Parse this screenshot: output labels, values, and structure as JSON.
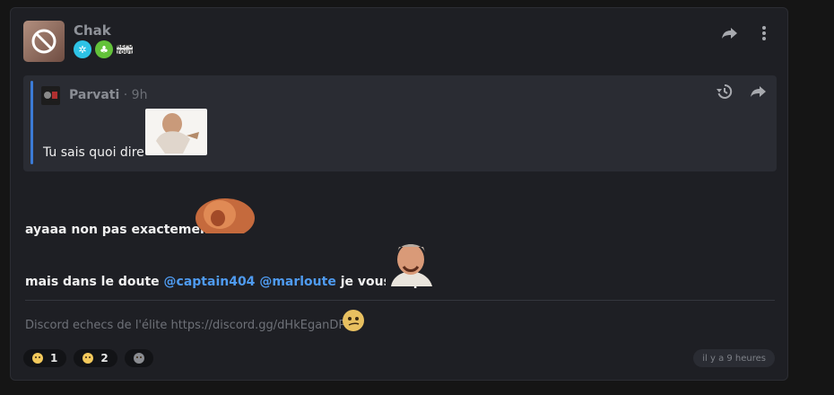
{
  "post": {
    "author": "Chak",
    "badges": [
      {
        "icon": "snowflake-badge-icon",
        "color": "#2ec3e6"
      },
      {
        "icon": "leaf-badge-icon",
        "color": "#63c23a"
      },
      {
        "icon": "mini-badge-icon",
        "color": "#d9d9d9"
      }
    ],
    "badge3_text": "REPO TOUT",
    "actions": [
      "share-icon",
      "more-vertical-icon"
    ]
  },
  "quote": {
    "author": "Parvati",
    "time": " · 9h",
    "text": "Tu sais quoi dire",
    "actions": [
      "history-icon",
      "share-icon"
    ]
  },
  "message": {
    "line1": "ayaaa non pas exactement",
    "line2_prefix": "mais dans le doute",
    "mention1": "@captain404",
    "mention2": "@marloute",
    "line2_suffix": "je vous nique"
  },
  "signature": "Discord echecs de l'élite https://discord.gg/dHkEganDPm",
  "reactions": [
    {
      "emoji": "slight-frown-emoji",
      "count": "1"
    },
    {
      "emoji": "sad-sweat-emoji",
      "count": "2"
    },
    {
      "emoji": "add-reaction-icon",
      "count": ""
    }
  ],
  "timestamp": "il y a 9 heures"
}
